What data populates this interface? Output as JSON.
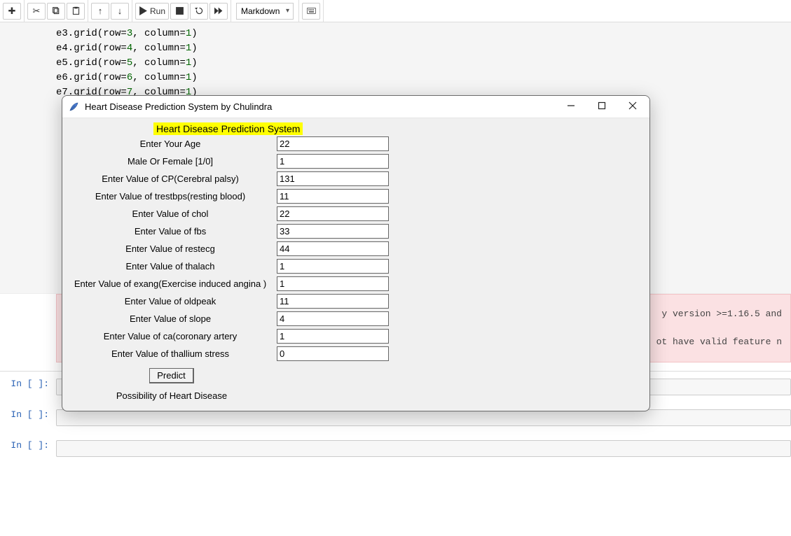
{
  "toolbar": {
    "run_label": "Run",
    "celltype_visible": "Markdown"
  },
  "code_lines": [
    "e3.grid(row=3, column=1)",
    "e4.grid(row=4, column=1)",
    "e5.grid(row=5, column=1)",
    "e6.grid(row=6, column=1)",
    "e7.grid(row=7, column=1)"
  ],
  "warning": {
    "line1": "y version >=1.16.5 and",
    "line2": "ot have valid feature n"
  },
  "cell_prompt": "In [ ]:",
  "tk": {
    "window_title": "Heart Disease Prediction System by Chulindra",
    "heading": "Heart Disease Prediction System",
    "predict_label": "Predict",
    "result_label": "Possibility of Heart Disease",
    "fields": [
      {
        "label": "Enter Your Age",
        "value": "22"
      },
      {
        "label": "Male Or Female [1/0]",
        "value": "1"
      },
      {
        "label": "Enter Value of CP(Cerebral palsy)",
        "value": "131"
      },
      {
        "label": "Enter Value of trestbps(resting blood)",
        "value": "11"
      },
      {
        "label": "Enter Value of chol",
        "value": "22"
      },
      {
        "label": "Enter Value of fbs",
        "value": "33"
      },
      {
        "label": "Enter Value of restecg",
        "value": "44"
      },
      {
        "label": "Enter Value of thalach",
        "value": "1"
      },
      {
        "label": "Enter Value of exang(Exercise induced angina )",
        "value": "1"
      },
      {
        "label": "Enter Value of oldpeak",
        "value": "11"
      },
      {
        "label": "Enter Value of slope",
        "value": "4"
      },
      {
        "label": "Enter Value of ca(coronary artery",
        "value": "1"
      },
      {
        "label": "Enter Value of thallium stress",
        "value": "0"
      }
    ]
  }
}
